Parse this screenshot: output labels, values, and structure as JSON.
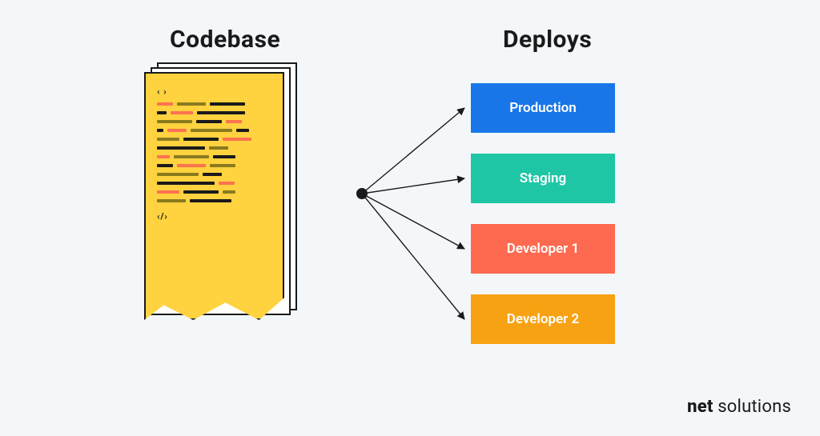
{
  "headings": {
    "codebase": "Codebase",
    "deploys": "Deploys"
  },
  "code_tags": {
    "open": "‹ ›",
    "close": "‹/›"
  },
  "deploy_targets": {
    "production": "Production",
    "staging": "Staging",
    "developer1": "Developer 1",
    "developer2": "Developer 2"
  },
  "deploy_colors": {
    "production": "#1976e8",
    "staging": "#1fc6a6",
    "developer1": "#fd6a4f",
    "developer2": "#f7a213"
  },
  "logo": {
    "prefix": "net",
    "suffix": " solutions"
  }
}
